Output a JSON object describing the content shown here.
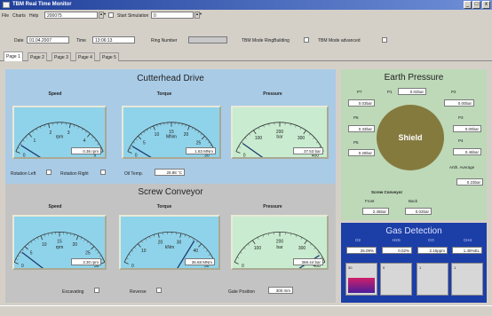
{
  "app": {
    "title": "TBM Real Time Monitor",
    "minimize": "_",
    "maximize": "□",
    "close": "x"
  },
  "menu": {
    "file": "File",
    "charts": "Charts",
    "help": "Help",
    "counter": "200075",
    "start_sim_label": "Start Simulation",
    "start_sim_value": "0"
  },
  "toolbar": {
    "date_label": "Date",
    "date_value": "01.04.2007",
    "time_label": "Time",
    "time_value": "13:06:13",
    "ring_label": "Ring Number",
    "ring_value": "",
    "ring_building_label": "TBM Mode RingBuilding",
    "advanced_label": "TBM Mode advanced"
  },
  "tabs": [
    "Page 1",
    "Page 2",
    "Page 3",
    "Page 4",
    "Page 5"
  ],
  "cutterhead": {
    "title": "Cutterhead Drive",
    "speed": {
      "label": "Speed",
      "unit": "rpm",
      "value": "0.36 rpm",
      "reading": 0.36,
      "range": [
        0,
        5
      ],
      "ticks": [
        "0",
        "1",
        "2",
        "3",
        "4",
        "5"
      ]
    },
    "torque": {
      "label": "Torque",
      "unit": "MNm",
      "value": "1.83 MNm",
      "reading": 1.83,
      "range": [
        0,
        30
      ],
      "ticks": [
        "0",
        "5",
        "10",
        "15",
        "20",
        "25",
        "30"
      ]
    },
    "pressure": {
      "label": "Pressure",
      "unit": "bar",
      "value": "37.53 bar",
      "reading": 37.53,
      "range": [
        0,
        400
      ],
      "ticks": [
        "0",
        "100",
        "200",
        "300",
        "400"
      ]
    },
    "rot_left": "Rotation Left",
    "rot_right": "Rotation Right",
    "oil_label": "Oil Temp.",
    "oil_value": "28.88 °C"
  },
  "screw": {
    "title": "Screw Conveyor",
    "speed": {
      "label": "Speed",
      "unit": "rpm",
      "value": "3.30 rpm",
      "reading": 3.3,
      "range": [
        0,
        30
      ],
      "ticks": [
        "0",
        "5",
        "10",
        "15",
        "20",
        "25",
        "30"
      ]
    },
    "torque": {
      "label": "Torque",
      "unit": "kNm",
      "value": "36.68 MNm",
      "reading": 36.68,
      "range": [
        0,
        50
      ],
      "ticks": [
        "0",
        "10",
        "20",
        "30",
        "40",
        "50"
      ]
    },
    "pressure": {
      "label": "Pressure",
      "unit": "bar",
      "value": "369.44 bar",
      "reading": 369.44,
      "range": [
        0,
        400
      ],
      "ticks": [
        "0",
        "100",
        "200",
        "300",
        "400"
      ]
    },
    "excavating": "Excavating",
    "reverse": "Reverse",
    "gate_label": "Gate Position",
    "gate_value": "300 mm"
  },
  "earth": {
    "title": "Earth Pressure",
    "shield": "Shield",
    "p7": {
      "label": "P7",
      "value": "0.03bar"
    },
    "p1": {
      "label": "P1",
      "value": "0.02bar"
    },
    "p2": {
      "label": "P2",
      "value": "0.00bar"
    },
    "p6": {
      "label": "P6",
      "value": "0.33bar"
    },
    "p3": {
      "label": "P3",
      "value": "0.00bar"
    },
    "p5": {
      "label": "P5",
      "value": "0.28bar"
    },
    "p4": {
      "label": "P4",
      "value": "0.46bar"
    },
    "avg_label": "Arith. Average",
    "avg_value": "0.23bar",
    "screw_label": "Screw Conveyor",
    "front_label": "Front",
    "front_value": "2.46bar",
    "back_label": "Back",
    "back_value": "0.02bar"
  },
  "gas": {
    "title": "Gas Detection",
    "cols": [
      {
        "label": "O2",
        "value": "25.09%"
      },
      {
        "label": "H2S",
        "value": "0.02%"
      },
      {
        "label": "CO",
        "value": "2.15ppm"
      },
      {
        "label": "CH4",
        "value": "1.45%EL"
      }
    ],
    "bars": [
      "30",
      "0",
      "1",
      "1"
    ],
    "fills": [
      0.5,
      0,
      0,
      0
    ]
  },
  "colors": {
    "gauge_face_blue": "#8fd3ea",
    "gauge_face_green": "#c9ecd0",
    "needle": "#1d3d70",
    "gas_fill_top": "#d0206a",
    "gas_fill_bottom": "#4a1c9a"
  }
}
